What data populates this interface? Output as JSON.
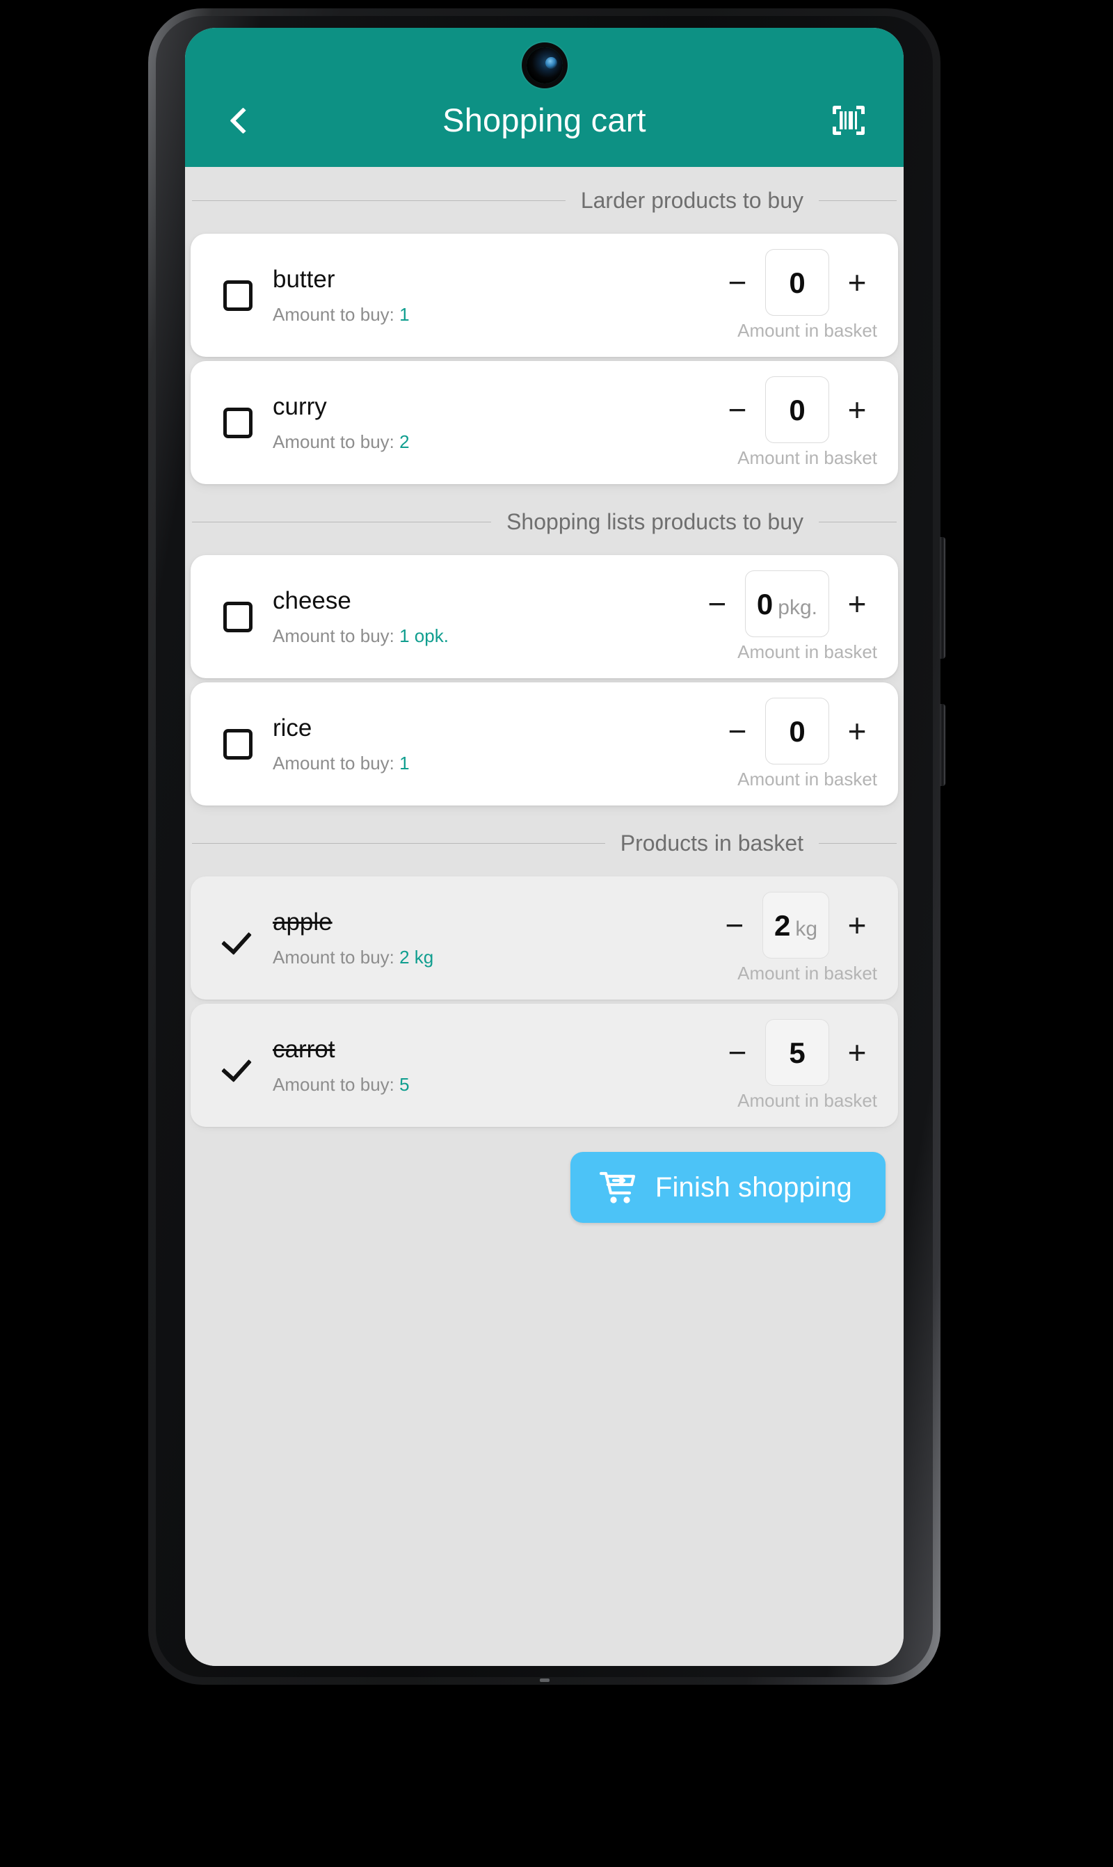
{
  "app": {
    "title": "Shopping cart",
    "back_icon": "chevron-left-icon",
    "scan_icon": "barcode-scan-icon",
    "header_color": "#0d9184",
    "accent_color": "#109e8f",
    "finish_color": "#4cc3f7",
    "background_color": "#e2e2e2"
  },
  "labels": {
    "amount_to_buy_prefix": "Amount to buy:",
    "amount_in_basket": "Amount in basket",
    "minus": "−",
    "plus": "+",
    "check": "✓"
  },
  "sections": [
    {
      "title": "Larder products to buy",
      "in_basket": false,
      "items": [
        {
          "name": "butter",
          "checked": false,
          "amount_to_buy": "1",
          "basket_qty": "0",
          "basket_unit": ""
        },
        {
          "name": "curry",
          "checked": false,
          "amount_to_buy": "2",
          "basket_qty": "0",
          "basket_unit": ""
        }
      ]
    },
    {
      "title": "Shopping lists products to buy",
      "in_basket": false,
      "items": [
        {
          "name": "cheese",
          "checked": false,
          "amount_to_buy": "1 opk.",
          "basket_qty": "0",
          "basket_unit": "pkg."
        },
        {
          "name": "rice",
          "checked": false,
          "amount_to_buy": "1",
          "basket_qty": "0",
          "basket_unit": ""
        }
      ]
    },
    {
      "title": "Products in basket",
      "in_basket": true,
      "items": [
        {
          "name": "apple",
          "checked": true,
          "amount_to_buy": "2 kg",
          "basket_qty": "2",
          "basket_unit": "kg"
        },
        {
          "name": "carrot",
          "checked": true,
          "amount_to_buy": "5",
          "basket_qty": "5",
          "basket_unit": ""
        }
      ]
    }
  ],
  "finish_button": {
    "label": "Finish shopping",
    "icon": "cart-arrow-in-icon"
  }
}
